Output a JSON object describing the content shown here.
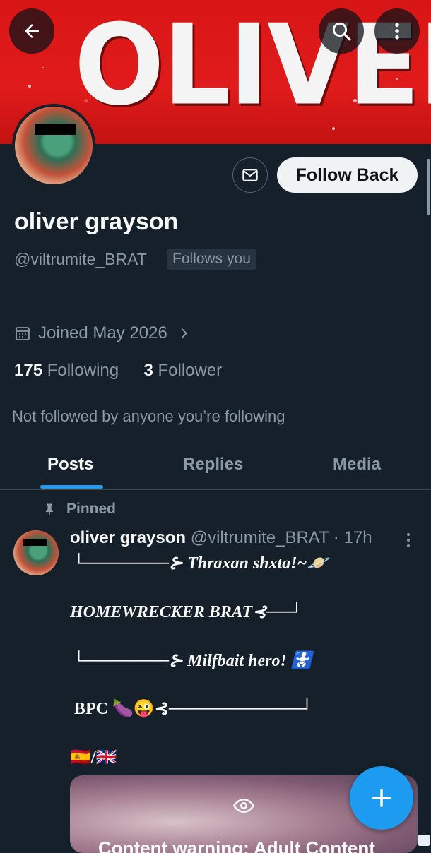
{
  "banner": {
    "word": "OLIVER",
    "color": "#e11b1b"
  },
  "header": {
    "back_icon": "arrow-left-icon",
    "search_icon": "search-icon",
    "more_icon": "more-vertical-icon"
  },
  "profile": {
    "name": "oliver grayson",
    "handle": "@viltrumite_BRAT",
    "follows_you": "Follows you",
    "joined": "Joined May 2026",
    "following_count": "175",
    "following_label": "Following",
    "followers_count": "3",
    "followers_label": "Follower",
    "not_followed": "Not followed by anyone you’re following"
  },
  "actions": {
    "follow_back": "Follow Back",
    "message_icon": "mail-icon"
  },
  "tabs": [
    {
      "label": "Posts",
      "active": true
    },
    {
      "label": "Replies"
    },
    {
      "label": "Media"
    }
  ],
  "post": {
    "pinned_label": "Pinned",
    "author": "oliver grayson",
    "handle": "@viltrumite_BRAT",
    "time": "· 17h",
    "lines": [
      "└───────⊱ Thraxan shxta!~🪐",
      "HOMEWRECKER BRAT⊰──┘",
      "└───────⊱ Milfbait hero! 🚼",
      "BPC 🍆😜⊰───────────┘",
      "🇪🇸/🇬🇧"
    ],
    "media_text": "Content warning: Adult Content"
  },
  "fab": {
    "icon": "plus-icon"
  },
  "colors": {
    "accent": "#1d9bf0",
    "background": "#15202b",
    "muted": "#8b98a5"
  }
}
